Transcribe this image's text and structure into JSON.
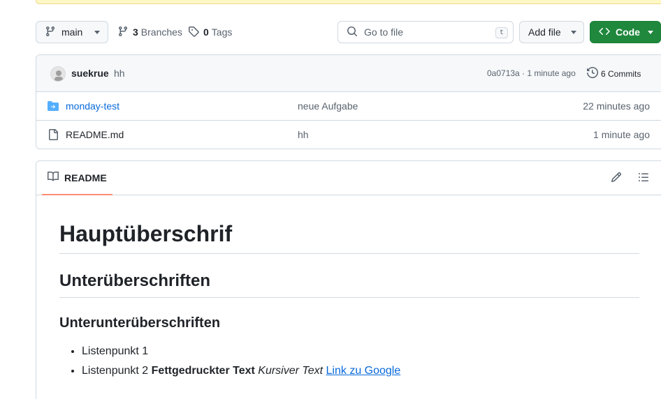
{
  "toolbar": {
    "branch_label": "main",
    "branches_count": "3",
    "branches_label": "Branches",
    "tags_count": "0",
    "tags_label": "Tags",
    "search_placeholder": "Go to file",
    "search_shortcut": "t",
    "add_file_label": "Add file",
    "code_label": "Code"
  },
  "latest_commit": {
    "author": "suekrue",
    "message": "hh",
    "sha_time": "0a0713a · 1 minute ago",
    "commits_label": "6 Commits"
  },
  "files": [
    {
      "type": "dir",
      "name": "monday-test",
      "message": "neue Aufgabe",
      "time": "22 minutes ago"
    },
    {
      "type": "file",
      "name": "README.md",
      "message": "hh",
      "time": "1 minute ago"
    }
  ],
  "readme": {
    "tab_label": "README",
    "h1": "Hauptüberschrif",
    "h2": "Unterüberschriften",
    "h3": "Unterunterüberschriften",
    "item1": "Listenpunkt 1",
    "item2_plain": "Listenpunkt 2",
    "item2_bold": "Fettgedruckter Text",
    "item2_italic": "Kursiver Text",
    "item2_link": "Link zu Google"
  },
  "colors": {
    "accent": "#0969da",
    "code_button": "#1f883d",
    "tab_underline": "#fd8c73",
    "banner": "#fff8c5"
  }
}
